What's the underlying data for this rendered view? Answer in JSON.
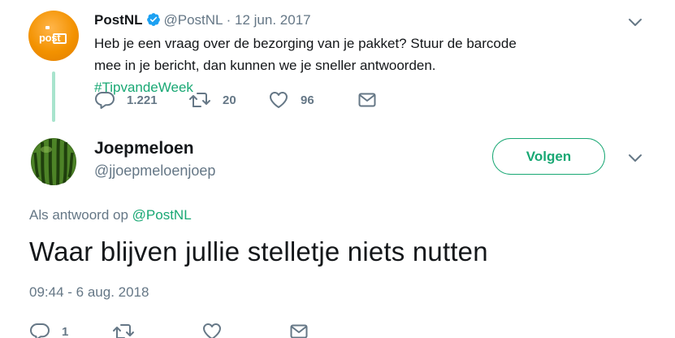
{
  "parent_tweet": {
    "name": "PostNL",
    "handle": "@PostNL",
    "separator": "·",
    "date": "12 jun. 2017",
    "text": "Heb je een vraag over de bezorging van je pakket? Stuur de barcode mee in je bericht, dan kunnen we je sneller antwoorden. ",
    "hashtag": "#TipvandeWeek",
    "avatar_logo": "post",
    "reply_count": "1.221",
    "retweet_count": "20",
    "like_count": "96",
    "colors": {
      "brand_orange": "#f39200",
      "thread_line": "#a8e4cd"
    }
  },
  "reply_tweet": {
    "name": "Joepmeloen",
    "handle": "@jjoepmeloenjoep",
    "follow_label": "Volgen",
    "in_reply_prefix": "Als antwoord op",
    "in_reply_mention": "@PostNL",
    "text": "Waar blijven jullie stelletje niets nutten",
    "timestamp": "09:44 - 6 aug. 2018",
    "reply_count": "1",
    "avatar_subject": "watermelon"
  },
  "icons": {
    "verified": "verified-badge-icon",
    "caret": "chevron-down-icon",
    "reply": "reply-icon",
    "retweet": "retweet-icon",
    "like": "heart-icon",
    "dm": "envelope-icon"
  },
  "colors": {
    "accent": "#19a874",
    "verified_blue": "#1da1f2",
    "text_primary": "#14171a",
    "text_secondary": "#657786"
  }
}
